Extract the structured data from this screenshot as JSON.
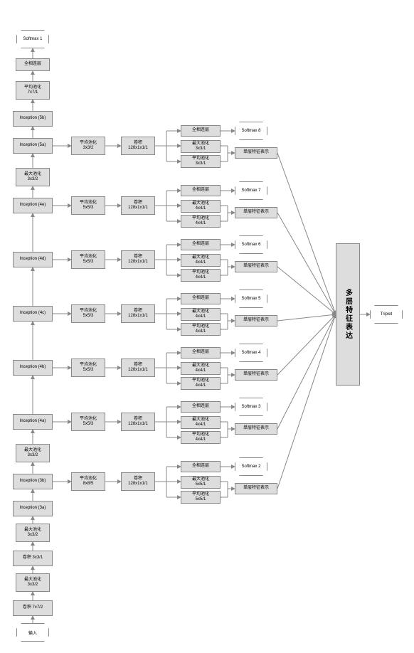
{
  "input": "输入",
  "softmax1": "Softmax 1",
  "triplet": "Triplet",
  "multi_layer_feature": "多层特征表达",
  "main_chain": {
    "conv7x7": {
      "l1": "卷积 7x7/2",
      "l2": ""
    },
    "maxpool1": {
      "l1": "最大池化",
      "l2": "3x3/2"
    },
    "conv3x3": {
      "l1": "卷积 3x3/1",
      "l2": ""
    },
    "maxpool2": {
      "l1": "最大池化",
      "l2": "3x3/2"
    },
    "i3a": {
      "l1": "Inception (3a)",
      "l2": ""
    },
    "i3b": {
      "l1": "Inception (3b)",
      "l2": ""
    },
    "maxpool3": {
      "l1": "最大池化",
      "l2": "3x3/2"
    },
    "i4a": {
      "l1": "Inception (4a)",
      "l2": ""
    },
    "i4b": {
      "l1": "Inception (4b)",
      "l2": ""
    },
    "i4c": {
      "l1": "Inception (4c)",
      "l2": ""
    },
    "i4d": {
      "l1": "Inception (4d)",
      "l2": ""
    },
    "i4e": {
      "l1": "Inception (4e)",
      "l2": ""
    },
    "maxpool4": {
      "l1": "最大池化",
      "l2": "3x3/2"
    },
    "i5a": {
      "l1": "Inception (5a)",
      "l2": ""
    },
    "i5b": {
      "l1": "Inception (5b)",
      "l2": ""
    },
    "avgpool_top": {
      "l1": "平均池化",
      "l2": "7x7/1"
    },
    "fc_top": {
      "l1": "全相连层",
      "l2": ""
    }
  },
  "branches": [
    {
      "tag": "3b",
      "ap": {
        "l1": "平均池化",
        "l2": "8x8/5"
      },
      "conv": {
        "l1": "卷积",
        "l2": "128x1x1/1"
      },
      "fc": "全相连层",
      "mp": {
        "l1": "最大池化",
        "l2": "5x5/1"
      },
      "avg": {
        "l1": "平均池化",
        "l2": "5x5/1"
      },
      "sfm": "Softmax 2",
      "slf": "单层特征表示"
    },
    {
      "tag": "4a",
      "ap": {
        "l1": "平均池化",
        "l2": "5x5/3"
      },
      "conv": {
        "l1": "卷积",
        "l2": "128x1x1/1"
      },
      "fc": "全相连层",
      "mp": {
        "l1": "最大池化",
        "l2": "4x4/1"
      },
      "avg": {
        "l1": "平均池化",
        "l2": "4x4/1"
      },
      "sfm": "Softmax 3",
      "slf": "单层特征表示"
    },
    {
      "tag": "4b",
      "ap": {
        "l1": "平均池化",
        "l2": "5x5/3"
      },
      "conv": {
        "l1": "卷积",
        "l2": "128x1x1/1"
      },
      "fc": "全相连层",
      "mp": {
        "l1": "最大池化",
        "l2": "4x4/1"
      },
      "avg": {
        "l1": "平均池化",
        "l2": "4x4/1"
      },
      "sfm": "Softmax 4",
      "slf": "单层特征表示"
    },
    {
      "tag": "4c",
      "ap": {
        "l1": "平均池化",
        "l2": "5x5/3"
      },
      "conv": {
        "l1": "卷积",
        "l2": "128x1x1/1"
      },
      "fc": "全相连层",
      "mp": {
        "l1": "最大池化",
        "l2": "4x4/1"
      },
      "avg": {
        "l1": "平均池化",
        "l2": "4x4/1"
      },
      "sfm": "Softmax 5",
      "slf": "单层特征表示"
    },
    {
      "tag": "4d",
      "ap": {
        "l1": "平均池化",
        "l2": "5x5/3"
      },
      "conv": {
        "l1": "卷积",
        "l2": "128x1x1/1"
      },
      "fc": "全相连层",
      "mp": {
        "l1": "最大池化",
        "l2": "4x4/1"
      },
      "avg": {
        "l1": "平均池化",
        "l2": "4x4/1"
      },
      "sfm": "Softmax 6",
      "slf": "单层特征表示"
    },
    {
      "tag": "4e",
      "ap": {
        "l1": "平均池化",
        "l2": "5x5/3"
      },
      "conv": {
        "l1": "卷积",
        "l2": "128x1x1/1"
      },
      "fc": "全相连层",
      "mp": {
        "l1": "最大池化",
        "l2": "4x4/1"
      },
      "avg": {
        "l1": "平均池化",
        "l2": "4x4/1"
      },
      "sfm": "Softmax 7",
      "slf": "单层特征表示"
    },
    {
      "tag": "5a",
      "ap": {
        "l1": "平均池化",
        "l2": "3x3/2"
      },
      "conv": {
        "l1": "卷积",
        "l2": "128x1x1/1"
      },
      "fc": "全相连层",
      "mp": {
        "l1": "最大池化",
        "l2": "3x3/1"
      },
      "avg": {
        "l1": "平均池化",
        "l2": "3x3/1"
      },
      "sfm": "Softmax 8",
      "slf": "单层特征表示"
    }
  ]
}
